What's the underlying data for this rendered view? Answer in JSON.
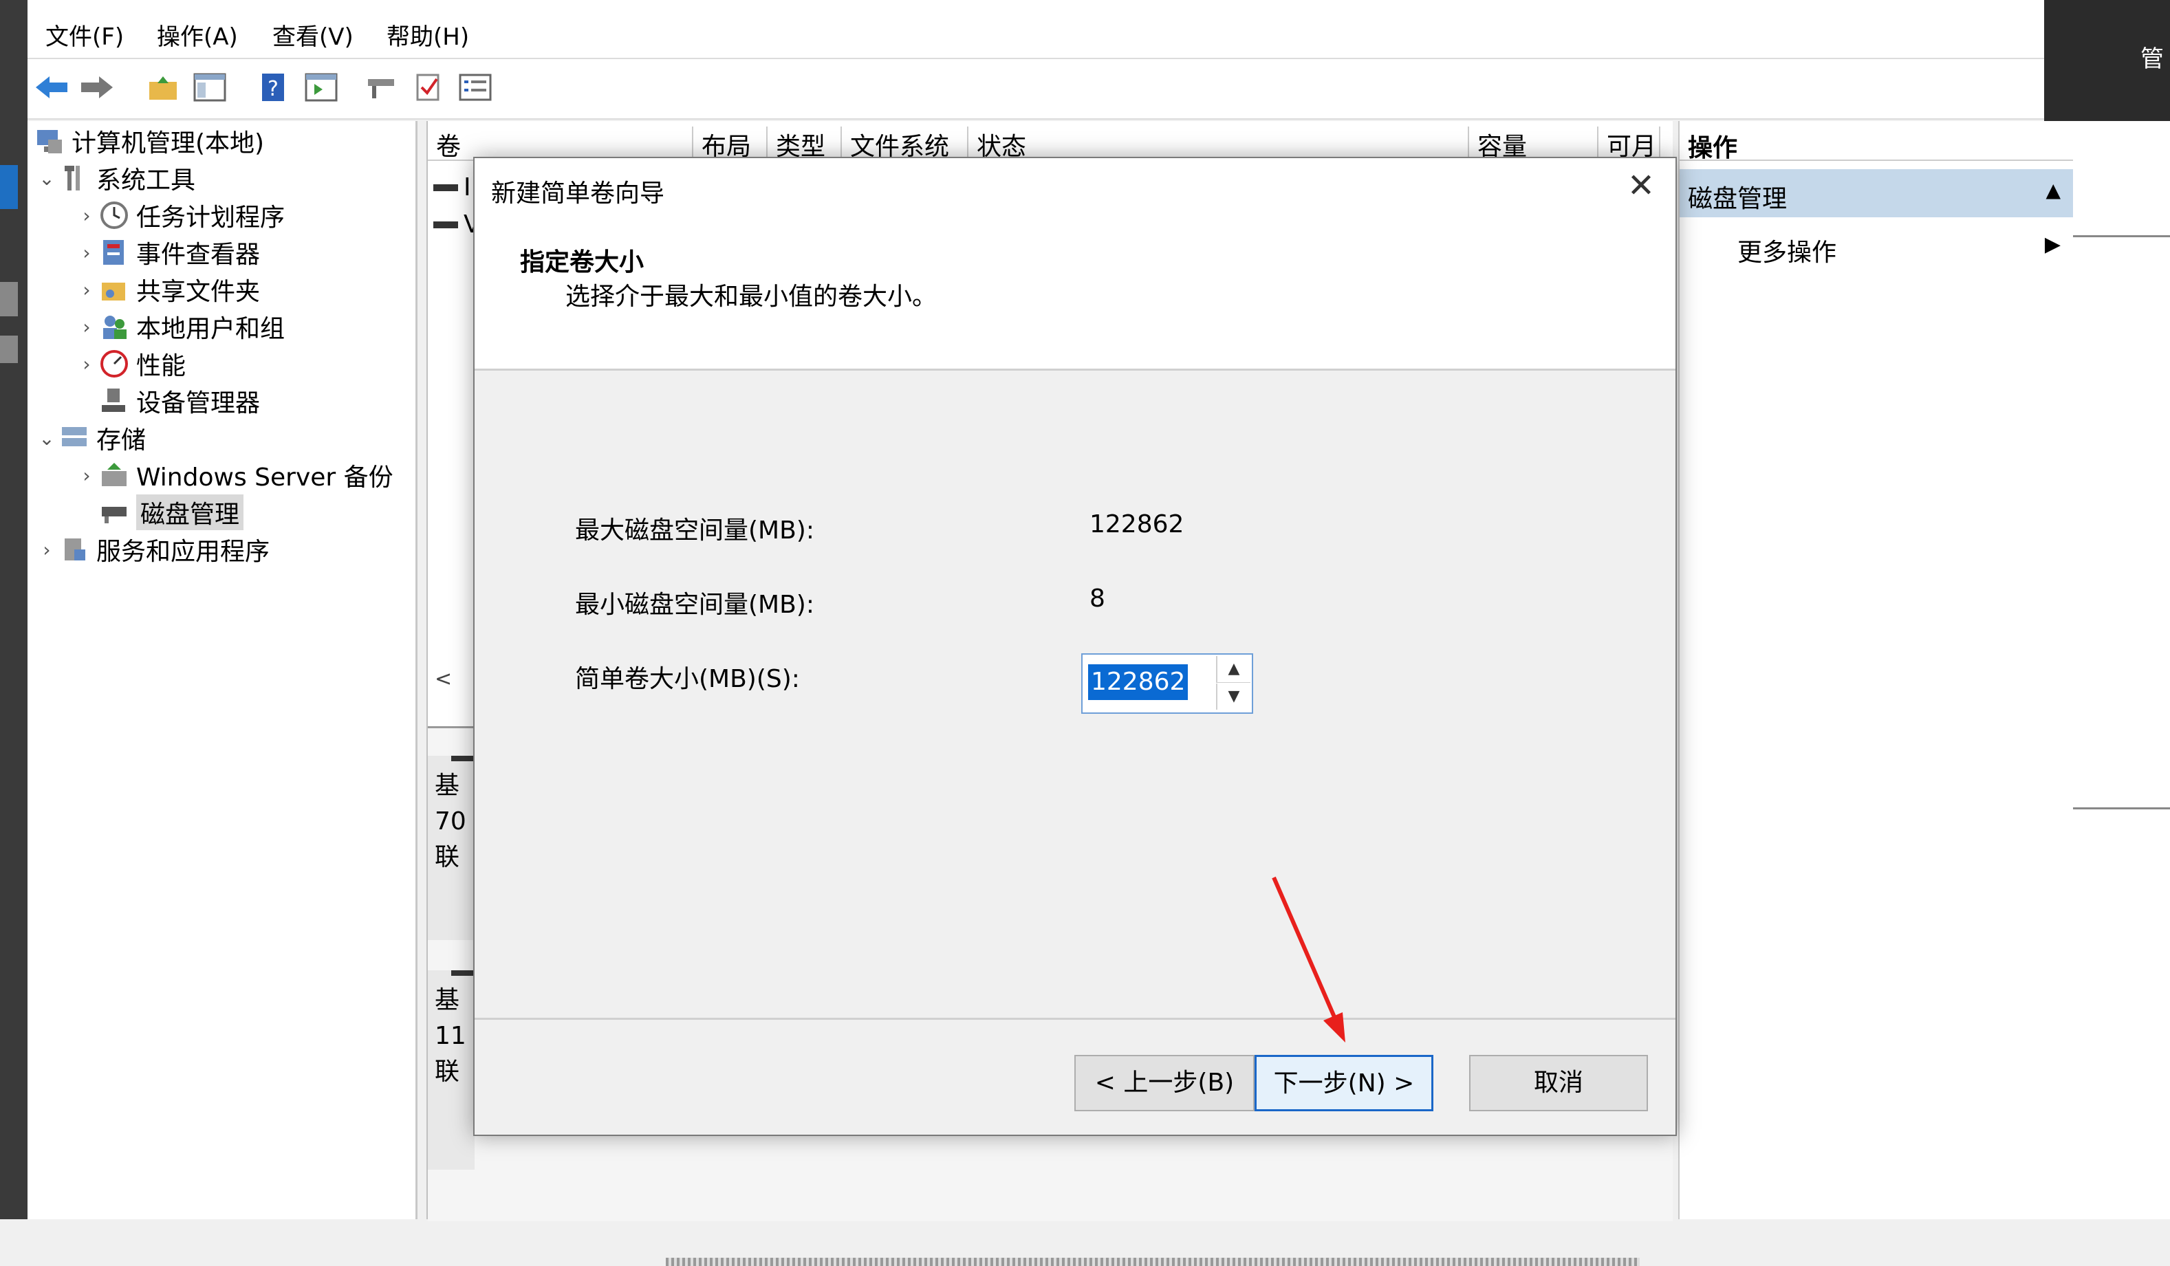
{
  "desktop": {
    "right_title": "管"
  },
  "menu": [
    "文件(F)",
    "操作(A)",
    "查看(V)",
    "帮助(H)"
  ],
  "toolbar_icons": [
    "back-icon",
    "forward-icon",
    "up-folder-icon",
    "show-hide-tree-icon",
    "help-icon",
    "action-pane-icon",
    "connect-icon",
    "check-icon",
    "properties-icon"
  ],
  "tree": {
    "root": "计算机管理(本地)",
    "system_tools": "系统工具",
    "task_scheduler": "任务计划程序",
    "event_viewer": "事件查看器",
    "shared_folders": "共享文件夹",
    "local_users": "本地用户和组",
    "performance": "性能",
    "device_manager": "设备管理器",
    "storage": "存储",
    "backup": "Windows Server 备份",
    "disk_mgmt": "磁盘管理",
    "services": "服务和应用程序"
  },
  "columns": [
    "卷",
    "布局",
    "类型",
    "文件系统",
    "状态",
    "容量",
    "可月"
  ],
  "list_rows_partial": [
    "I",
    "V"
  ],
  "disk_tiles": [
    [
      "基",
      "70",
      "联"
    ],
    [
      "基",
      "11",
      "联"
    ]
  ],
  "scroll_left": "<",
  "actions": {
    "header": "操作",
    "selected": "磁盘管理",
    "more": "更多操作"
  },
  "dialog": {
    "title": "新建简单卷向导",
    "heading": "指定卷大小",
    "subheading": "选择介于最大和最小值的卷大小。",
    "max_label": "最大磁盘空间量(MB):",
    "max_value": "122862",
    "min_label": "最小磁盘空间量(MB):",
    "min_value": "8",
    "size_label": "简单卷大小(MB)(S):",
    "size_value": "122862",
    "back_button": "< 上一步(B)",
    "next_button": "下一步(N) >",
    "cancel_button": "取消"
  }
}
